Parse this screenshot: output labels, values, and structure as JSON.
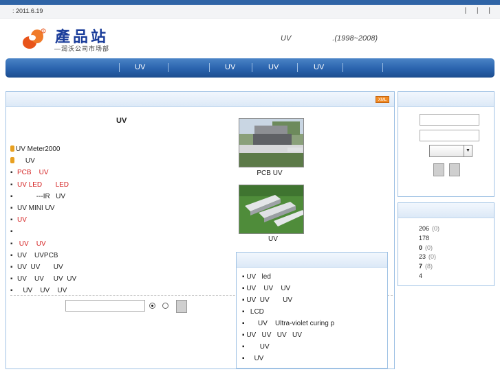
{
  "topbar": {
    "date": ": 2011.6.19",
    "separators": [
      "|",
      "|",
      "|"
    ]
  },
  "brand": {
    "title": "產品站",
    "subtitle": "—润沃公司市场部",
    "slogan": "UV",
    "years": ".(1998~2008)"
  },
  "nav": {
    "items": [
      "UV",
      "UV",
      "UV",
      "UV"
    ]
  },
  "main": {
    "badge": "XML",
    "title": "UV",
    "links": [
      {
        "text": "UV Meter2000",
        "style": "icon"
      },
      {
        "text": "     UV",
        "style": "icon"
      },
      {
        "text": "PCB    UV",
        "style": "red"
      },
      {
        "text": "UV LED       LED",
        "style": "red"
      },
      {
        "text": "          ---IR   UV",
        "style": "plain"
      },
      {
        "text": "UV MINI UV",
        "style": "plain"
      },
      {
        "text": "UV",
        "style": "red"
      },
      {
        "text": "",
        "style": "plain"
      },
      {
        "text": " UV    UV",
        "style": "red"
      },
      {
        "text": "UV    UVPCB",
        "style": "plain"
      },
      {
        "text": "UV  UV       UV",
        "style": "plain"
      },
      {
        "text": "UV    UV     UV  UV",
        "style": "plain"
      },
      {
        "text": "   UV    UV    UV",
        "style": "plain"
      }
    ],
    "photos": [
      {
        "caption": "PCB UV"
      },
      {
        "caption": "UV"
      }
    ]
  },
  "subpanel": {
    "items": [
      "UV   led",
      "UV    UV    UV",
      "UV  UV       UV",
      "  LCD",
      "      UV    Ultra-violet curing p",
      "UV   UV   UV   UV",
      "       UV",
      "    UV"
    ]
  },
  "stats": {
    "rows": [
      {
        "value": "206",
        "extra": "(0)"
      },
      {
        "value": "178",
        "extra": ""
      },
      {
        "value": "0",
        "extra": "(0)",
        "bold": true
      },
      {
        "value": "23",
        "extra": "(0)"
      },
      {
        "value": "7",
        "extra": "(8)",
        "bold": true
      },
      {
        "value": "4",
        "extra": ""
      }
    ]
  },
  "colors": {
    "brand_blue": "#1b3d9a",
    "nav_blue": "#2a63ad",
    "link_red": "#d42020",
    "panel_border": "#9ec1e4"
  }
}
